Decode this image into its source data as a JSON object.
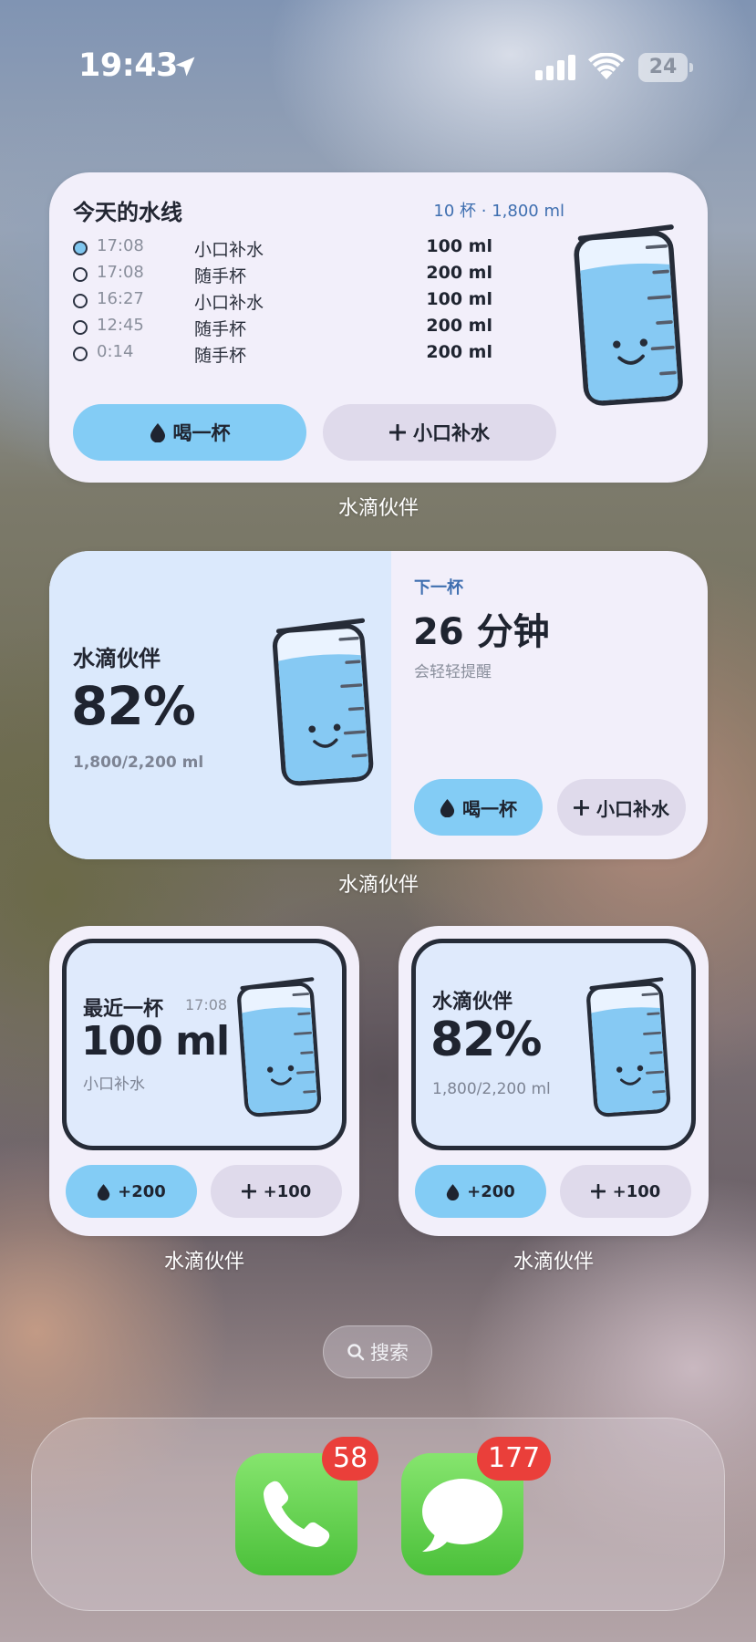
{
  "status_bar": {
    "time": "19:43",
    "battery": "24"
  },
  "widget_timeline": {
    "title": "今天的水线",
    "summary": "10 杯 · 1,800 ml",
    "log": [
      {
        "time": "17:08",
        "name": "小口补水",
        "amount": "100 ml"
      },
      {
        "time": "17:08",
        "name": "随手杯",
        "amount": "200 ml"
      },
      {
        "time": "16:27",
        "name": "小口补水",
        "amount": "100 ml"
      },
      {
        "time": "12:45",
        "name": "随手杯",
        "amount": "200 ml"
      },
      {
        "time": "0:14",
        "name": "随手杯",
        "amount": "200 ml"
      }
    ],
    "drink_button": "喝一杯",
    "sip_button": "小口补水",
    "label": "水滴伙伴"
  },
  "widget_medium": {
    "app_name": "水滴伙伴",
    "percent": "82%",
    "amount": "1,800/2,200 ml",
    "next_label": "下一杯",
    "next_time": "26 分钟",
    "note": "会轻轻提醒",
    "drink_button": "喝一杯",
    "sip_button": "小口补水",
    "label": "水滴伙伴"
  },
  "widget_small_recent": {
    "title": "最近一杯",
    "time": "17:08",
    "amount": "100 ml",
    "name": "小口补水",
    "add200": "+200",
    "add100": "+100",
    "label": "水滴伙伴"
  },
  "widget_small_progress": {
    "title": "水滴伙伴",
    "percent": "82%",
    "amount": "1,800/2,200 ml",
    "add200": "+200",
    "add100": "+100",
    "label": "水滴伙伴"
  },
  "search": {
    "label": "搜索"
  },
  "dock": {
    "apps": [
      {
        "name": "phone",
        "badge": "58"
      },
      {
        "name": "messages",
        "badge": "177"
      }
    ]
  },
  "colors": {
    "accent_blue": "#83ccf5",
    "button_gray": "#dfdaeb",
    "badge_red": "#ea3f3a",
    "widget_bg": "#f2effa"
  }
}
